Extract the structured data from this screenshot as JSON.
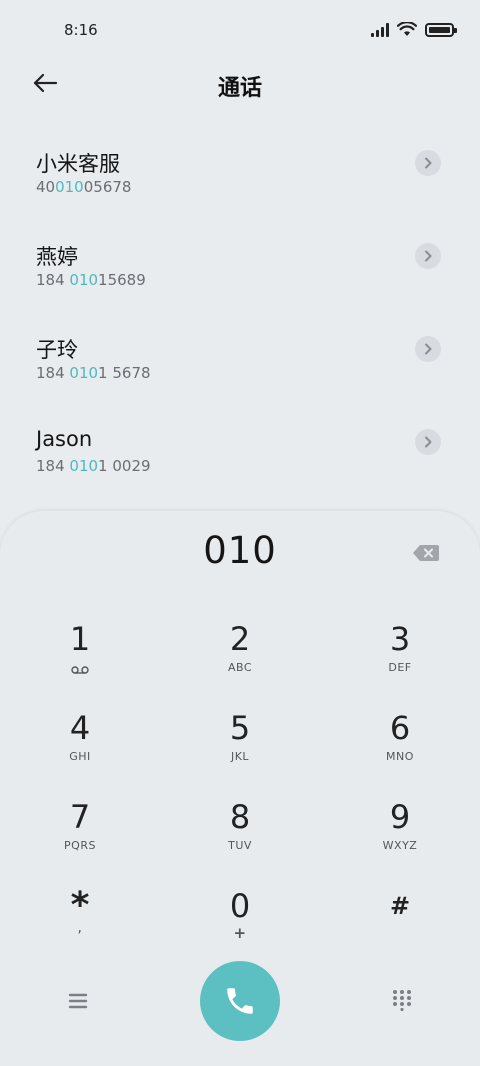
{
  "status_bar": {
    "time": "8:16",
    "icons": [
      "signal-icon",
      "wifi-icon",
      "battery-icon"
    ]
  },
  "header": {
    "title": "通话",
    "back_icon": "arrow-left-icon"
  },
  "contacts": [
    {
      "name": "小米客服",
      "number_prefix": "40",
      "number_match": "010",
      "number_suffix": "05678"
    },
    {
      "name": "燕婷",
      "number_prefix": "184 ",
      "number_match": "010",
      "number_suffix": "15689"
    },
    {
      "name": "子玲",
      "number_prefix": "184 ",
      "number_match": "010",
      "number_suffix": "1 5678"
    },
    {
      "name": "Jason",
      "number_prefix": "184 ",
      "number_match": "010",
      "number_suffix": "1 0029"
    }
  ],
  "dialpad": {
    "input": "010",
    "keys": [
      {
        "digit": "1",
        "letters": ""
      },
      {
        "digit": "2",
        "letters": "ABC"
      },
      {
        "digit": "3",
        "letters": "DEF"
      },
      {
        "digit": "4",
        "letters": "GHI"
      },
      {
        "digit": "5",
        "letters": "JKL"
      },
      {
        "digit": "6",
        "letters": "MNO"
      },
      {
        "digit": "7",
        "letters": "PQRS"
      },
      {
        "digit": "8",
        "letters": "TUV"
      },
      {
        "digit": "9",
        "letters": "WXYZ"
      },
      {
        "digit": "*",
        "letters": ","
      },
      {
        "digit": "0",
        "letters": "+"
      },
      {
        "digit": "#",
        "letters": ""
      }
    ]
  },
  "colors": {
    "accent": "#5cc0c3",
    "match_highlight": "#4fb8be",
    "background": "#e9ecef"
  }
}
